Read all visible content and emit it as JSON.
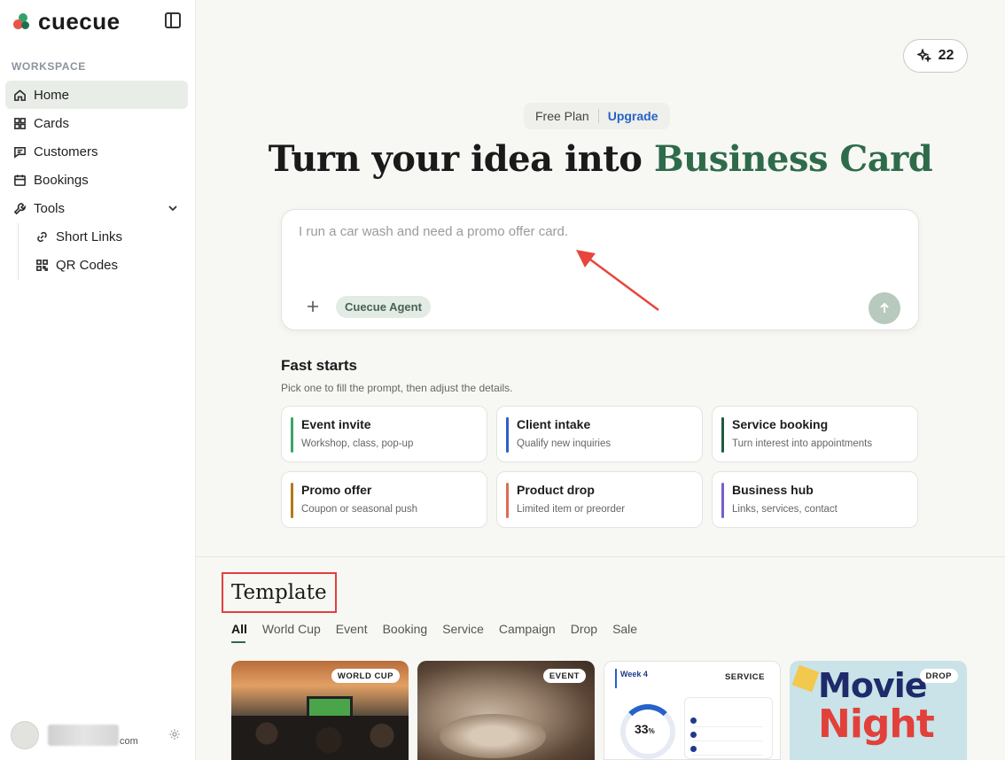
{
  "app": {
    "brand": "cuecue"
  },
  "sidebar": {
    "section_label": "WORKSPACE",
    "items": [
      {
        "label": "Home",
        "icon": "home-icon",
        "active": true
      },
      {
        "label": "Cards",
        "icon": "grid-icon"
      },
      {
        "label": "Customers",
        "icon": "message-icon"
      },
      {
        "label": "Bookings",
        "icon": "calendar-icon"
      },
      {
        "label": "Tools",
        "icon": "wrench-icon",
        "expanded": true
      }
    ],
    "sub_items": [
      {
        "label": "Short Links",
        "icon": "link-icon"
      },
      {
        "label": "QR Codes",
        "icon": "qr-code-icon"
      }
    ],
    "user": {
      "domain_suffix": "com"
    }
  },
  "header": {
    "credits": "22"
  },
  "plan": {
    "current": "Free Plan",
    "upgrade": "Upgrade"
  },
  "hero": {
    "title_prefix": "Turn your idea into ",
    "title_accent": "Business Card"
  },
  "prompt": {
    "placeholder": "I run a car wash and need a promo offer card.",
    "agent_label": "Cuecue Agent"
  },
  "fast_starts": {
    "title": "Fast starts",
    "subtitle": "Pick one to fill the prompt, then adjust the details.",
    "cards": [
      {
        "name": "Event invite",
        "desc": "Workshop, class, pop-up",
        "color": "#3aa66b"
      },
      {
        "name": "Client intake",
        "desc": "Qualify new inquiries",
        "color": "#2f5fc4"
      },
      {
        "name": "Service booking",
        "desc": "Turn interest into appointments",
        "color": "#1f5a40"
      },
      {
        "name": "Promo offer",
        "desc": "Coupon or seasonal push",
        "color": "#b07a16"
      },
      {
        "name": "Product drop",
        "desc": "Limited item or preorder",
        "color": "#e06a55"
      },
      {
        "name": "Business hub",
        "desc": "Links, services, contact",
        "color": "#7a5ccc"
      }
    ]
  },
  "templates": {
    "title": "Template",
    "tabs": [
      "All",
      "World Cup",
      "Event",
      "Booking",
      "Service",
      "Campaign",
      "Drop",
      "Sale"
    ],
    "cards": [
      {
        "tag": "WORLD CUP"
      },
      {
        "tag": "EVENT"
      },
      {
        "tag": "SERVICE",
        "week": "Week 4",
        "percent": "33",
        "percent_unit": "%"
      },
      {
        "tag": "DROP",
        "line1": "Movie",
        "line2": "Night"
      }
    ]
  },
  "colors": {
    "accent_green": "#2e6b4a",
    "link_blue": "#2563c9",
    "highlight_red": "#e0403f"
  }
}
